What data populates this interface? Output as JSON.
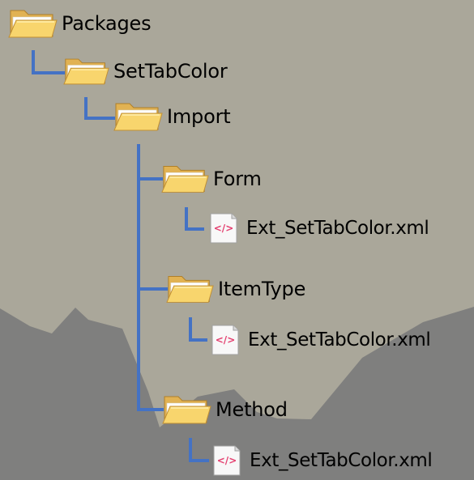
{
  "tree": {
    "root": {
      "label": "Packages",
      "icon": "folder-icon"
    },
    "setTabColor": {
      "label": "SetTabColor",
      "icon": "folder-icon"
    },
    "import": {
      "label": "Import",
      "icon": "folder-icon"
    },
    "form": {
      "label": "Form",
      "icon": "folder-icon",
      "file": {
        "label": "Ext_SetTabColor.xml",
        "icon": "xml-file-icon"
      }
    },
    "itemType": {
      "label": "ItemType",
      "icon": "folder-icon",
      "file": {
        "label": "Ext_SetTabColor.xml",
        "icon": "xml-file-icon"
      }
    },
    "method": {
      "label": "Method",
      "icon": "folder-icon",
      "file": {
        "label": "Ext_SetTabColor.xml",
        "icon": "xml-file-icon"
      }
    }
  },
  "colors": {
    "background": "#aaa79a",
    "background_dark": "#7f7f7e",
    "connector": "#4472c4",
    "xml_tag": "#e43f6f"
  }
}
